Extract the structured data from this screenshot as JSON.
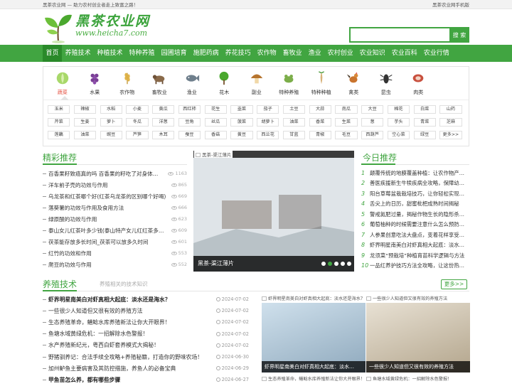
{
  "topbar": {
    "left": "黑茶农业网 — 助力农村创业者走上致富之路！",
    "right": "黑茶农业网手机版"
  },
  "logo": {
    "title": "黑茶农业网",
    "url": "www.heicha7.com"
  },
  "search": {
    "placeholder": "",
    "button": "搜 索"
  },
  "nav": [
    "首页",
    "养殖技术",
    "种植技术",
    "特种养殖",
    "园圃培育",
    "施肥药病",
    "养花技巧",
    "农作物",
    "畜牧业",
    "渔业",
    "农村创业",
    "农业知识",
    "农业百科",
    "农业行情"
  ],
  "categories": [
    {
      "label": "蔬菜",
      "icon": "cabbage-icon"
    },
    {
      "label": "水果",
      "icon": "grapes-icon"
    },
    {
      "label": "农作物",
      "icon": "wheat-icon"
    },
    {
      "label": "畜牧业",
      "icon": "cattle-icon"
    },
    {
      "label": "渔业",
      "icon": "fish-icon"
    },
    {
      "label": "花木",
      "icon": "tree-icon"
    },
    {
      "label": "副业",
      "icon": "mushroom-icon"
    },
    {
      "label": "特种养殖",
      "icon": "frog-icon"
    },
    {
      "label": "特种种植",
      "icon": "ginseng-icon"
    },
    {
      "label": "禽类",
      "icon": "rooster-icon"
    },
    {
      "label": "昆虫",
      "icon": "insect-icon"
    },
    {
      "label": "肉类",
      "icon": "meat-icon"
    }
  ],
  "tags": [
    [
      "玉米",
      "辣椒",
      "水稻",
      "小麦",
      "黄瓜",
      "西红柿",
      "花生",
      "韭菜",
      "茄子",
      "土豆",
      "大蒜",
      "南瓜",
      "大豆",
      "棉花",
      "白菜",
      "山药"
    ],
    [
      "芹菜",
      "生姜",
      "萝卜",
      "冬瓜",
      "洋葱",
      "豆角",
      "丝瓜",
      "菠菜",
      "胡萝卜",
      "油菜",
      "香菜",
      "生菜",
      "葱",
      "芋头",
      "青菜",
      "芝麻"
    ],
    [
      "莲藕",
      "油菜",
      "豌豆",
      "芦笋",
      "木耳",
      "蚕豆",
      "香菇",
      "黄豆",
      "西兰花",
      "甘蓝",
      "青椒",
      "毛豆",
      "西葫芦",
      "空心菜",
      "绿豆",
      "更多>>"
    ]
  ],
  "jingcai": {
    "title": "精彩推荐",
    "items": [
      {
        "t": "百香果籽致癌真的吗 百香果的籽吃了对身体…",
        "v": "1163"
      },
      {
        "t": "洋车前子壳的功效与作用",
        "v": "865"
      },
      {
        "t": "乌龙茶和红茶哪个好(红茶乌龙茶的区别哪个好喝)",
        "v": "669"
      },
      {
        "t": "落葵薯的功效与作用及食用方法",
        "v": "666"
      },
      {
        "t": "绿原酸的功效与作用",
        "v": "623"
      },
      {
        "t": "泰山女儿红茶叶多少钱(泰山特产女儿红红茶多…",
        "v": "609"
      },
      {
        "t": "茯茶能存放多长时间_茯茶可以放多久时间",
        "v": "601"
      },
      {
        "t": "红竹的功效和作用",
        "v": "553"
      },
      {
        "t": "爬豆的功效与作用",
        "v": "552"
      }
    ]
  },
  "slider": {
    "img_label": "黑茶-渠江薄片",
    "caption": "黑茶-渠江薄片"
  },
  "today": {
    "title": "今日推荐",
    "items": [
      "颠覆传统的地膜覆盖种植：让农作物产…",
      "善医疾援新生牛犊疾病全攻略，保障幼…",
      "阳台草莓盆栽栽培技巧，让你轻松实现…",
      "舌尖上的日历，甜蜜枇杷成熟时间揭秘",
      "警戒氮肥过量，揭秘作物生长的隐形杀…",
      "葡萄柚种的时候需要注意什么怎么预防…",
      "人参果创意吃法大盘点，变着花样享受…",
      "虾界明星南美白对虾真相大起底：淡水…",
      "龙须菜“预栽培”种植育苗科学逻辑与方法",
      "一品红养护技巧方法全攻略，让这份热…"
    ]
  },
  "yangzhi": {
    "title": "养殖技术",
    "subtitle": "养殖相关的技术知识",
    "more": "更多>>",
    "items": [
      {
        "t": "虾界明星南美白对虾真相大起底：淡水还是海水？",
        "d": "2024-07-02",
        "bold": true
      },
      {
        "t": "一些很少人知道但又很有效的养殖方法",
        "d": "2024-07-02",
        "bold": false
      },
      {
        "t": "生态养殖革命，鳝鲶水库养殖新法让你大开眼界！",
        "d": "2024-07-02",
        "bold": false
      },
      {
        "t": "鱼塘水域黄绿危机：一招解除水色警报！",
        "d": "2024-07-02",
        "bold": false
      },
      {
        "t": "水产养殖新纪元，粤西白虾套养模式大揭秘！",
        "d": "2024-07-02",
        "bold": false
      },
      {
        "t": "野猪驯养记：合法手续全攻略+养殖秘籍，打造你的野味农场！",
        "d": "2024-06-30",
        "bold": false
      },
      {
        "t": "加州鲈鱼主要病害及其防控措施，养鱼人的必备宝典",
        "d": "2024-06-29",
        "bold": false
      },
      {
        "t": "甲鱼苗怎么养，都有哪些步骤",
        "d": "2024-06-27",
        "bold": true
      }
    ],
    "thumbs": [
      {
        "top": "虾界明星南美白对虾真相大起底：淡水还是海水？",
        "cap": "虾界明星南美白对虾真相大起底：淡水…"
      },
      {
        "top": "一些很少人知道但又很有效的养殖方法",
        "cap": "一些很少人知道但又很有效的养殖方法"
      },
      {
        "top": "生态养殖革命，鳝鲶水库养殖新法让你大开眼界！",
        "cap": ""
      },
      {
        "top": "鱼塘水域黄绿危机：一招解除水色警报！",
        "cap": ""
      }
    ]
  }
}
